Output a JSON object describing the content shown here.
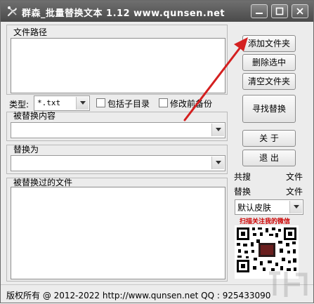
{
  "window": {
    "title": "群森_批量替换文本  1.12   www.qunsen.net"
  },
  "sections": {
    "file_path_label": "文件路径",
    "type_label": "类型:",
    "type_value": "*.txt",
    "include_subdirs_label": "包括子目录",
    "backup_label": "修改前备份",
    "search_label": "被替换内容",
    "replace_label": "替换为",
    "replaced_files_label": "被替换过的文件"
  },
  "buttons": {
    "add_folder": "添加文件夹",
    "delete_selected": "删除选中",
    "clear_folder": "清空文件夹",
    "find_replace": "寻找替换",
    "about": "关 于",
    "exit": "退 出"
  },
  "stats": {
    "searched_label": "共搜",
    "searched_unit": "文件",
    "replaced_label": "替换",
    "replaced_unit": "文件"
  },
  "skin": {
    "selected": "默认皮肤"
  },
  "qr": {
    "caption": "扫描关注我的微信"
  },
  "status": {
    "text": "版权所有 @ 2012-2022   http://www.qunsen.net   QQ : 925433090"
  },
  "colors": {
    "titlebar": "#5b5b5b",
    "arrow": "#d42020",
    "qr_caption": "#cc0000"
  }
}
